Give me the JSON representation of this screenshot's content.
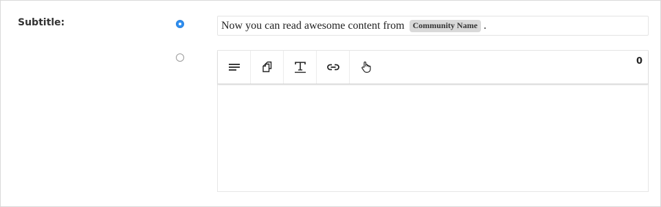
{
  "subtitle_field": {
    "label": "Subtitle:",
    "preset_option": {
      "selected": true,
      "text_before": "Now you can read awesome content from",
      "token": "Community Name",
      "text_after": "."
    },
    "custom_option": {
      "selected": false,
      "char_count": "0",
      "toolbar": [
        {
          "name": "align-left-icon"
        },
        {
          "name": "copy-icon"
        },
        {
          "name": "text-format-icon"
        },
        {
          "name": "link-icon"
        },
        {
          "name": "pointer-hand-icon"
        }
      ],
      "content": ""
    }
  },
  "colors": {
    "radio_selected": "#2f8ff0",
    "token_bg": "#d9d9d9"
  }
}
